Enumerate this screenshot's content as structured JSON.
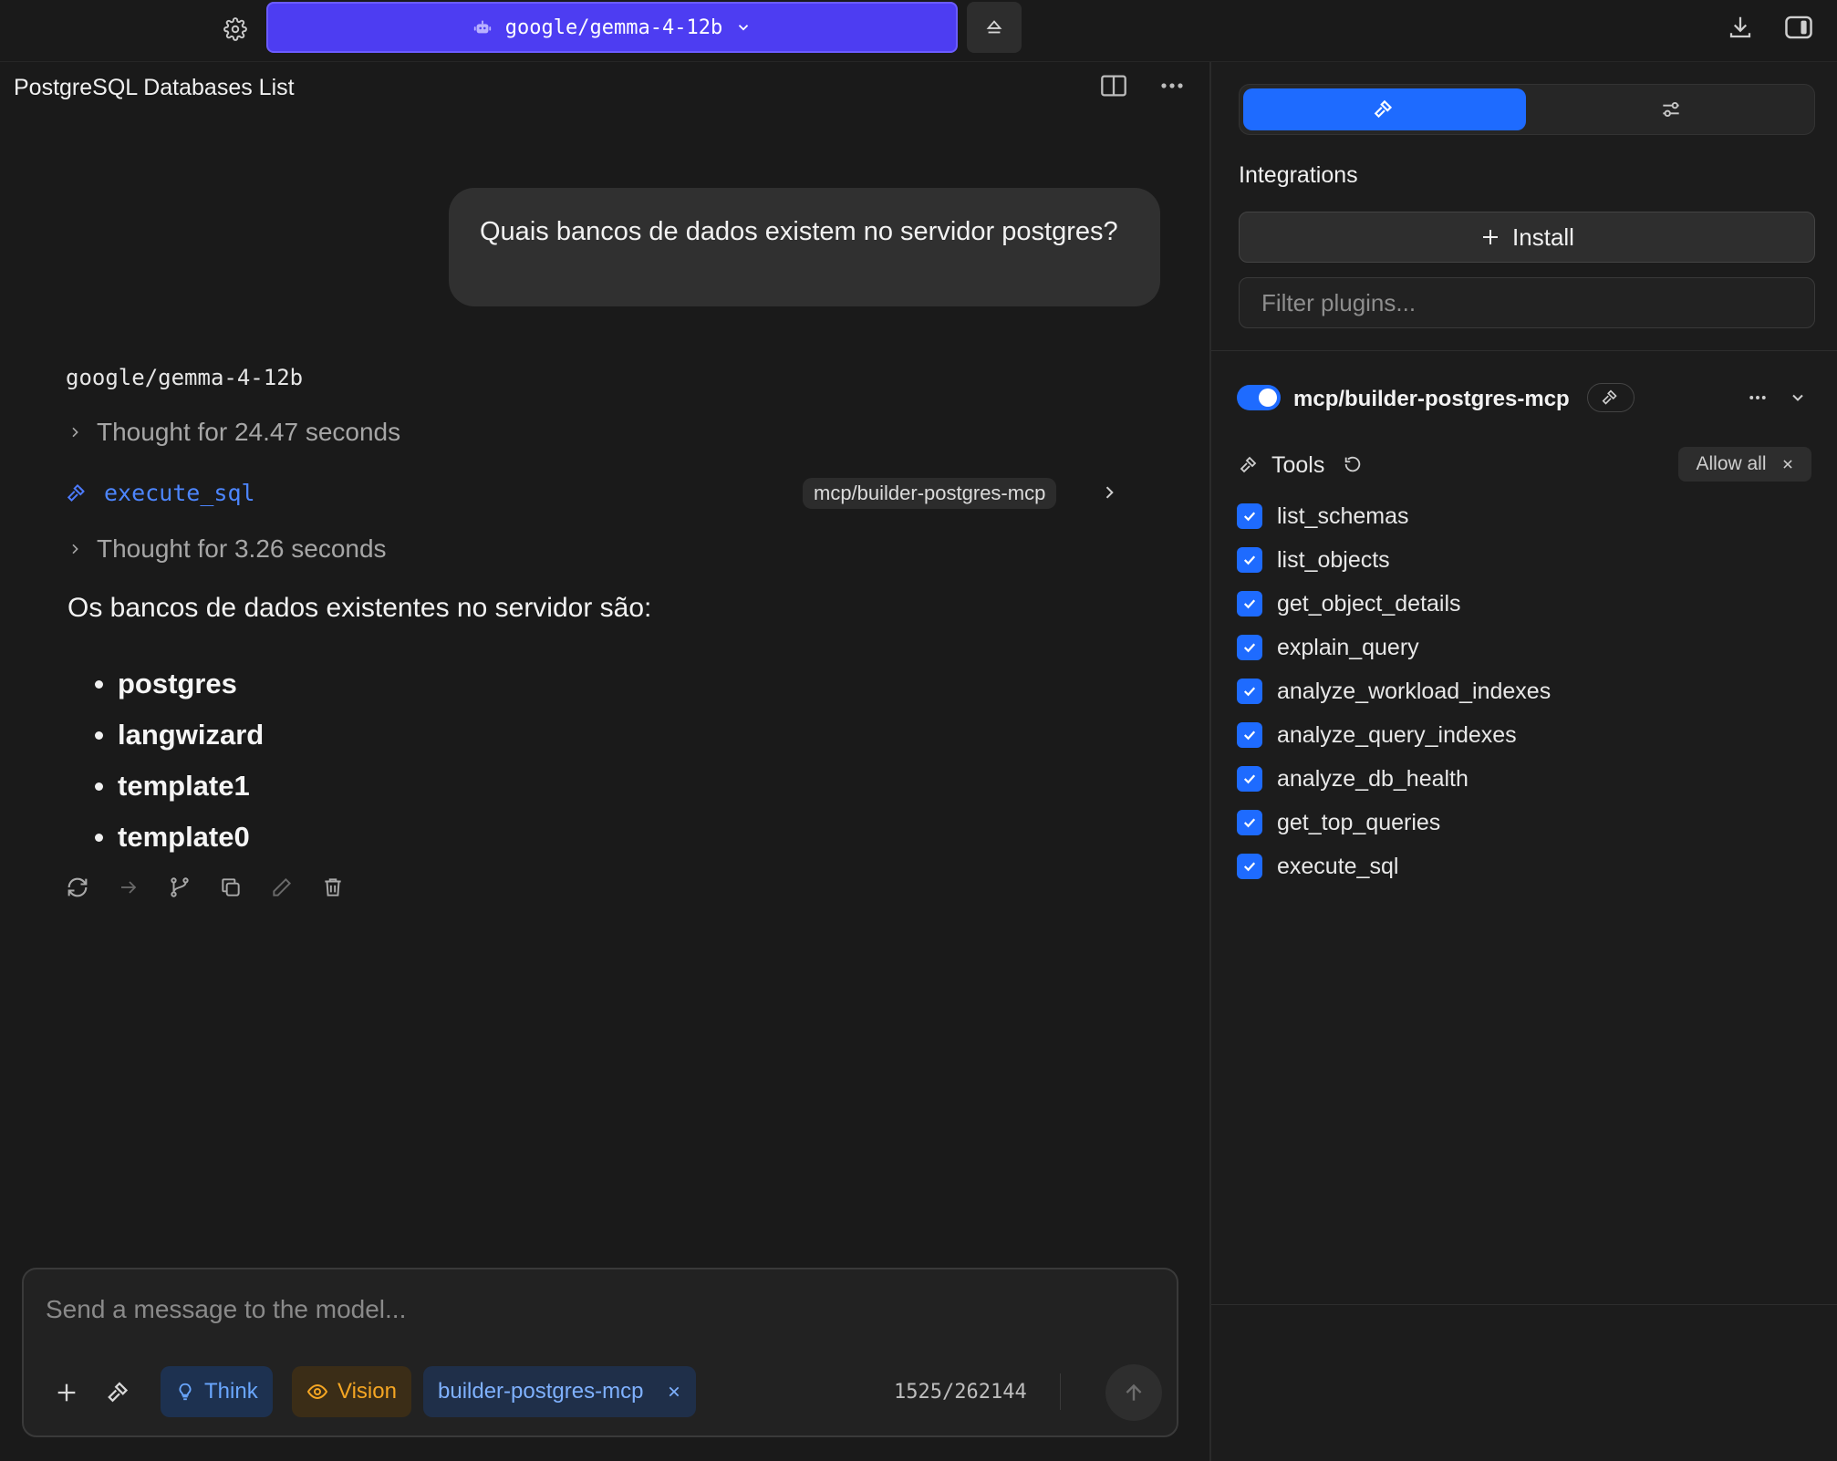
{
  "topbar": {
    "model_name": "google/gemma-4-12b",
    "icons": [
      "gear-icon",
      "robot-icon",
      "chevron-down-icon",
      "eject-icon",
      "download-icon",
      "sidebar-toggle-icon"
    ]
  },
  "chat": {
    "title": "PostgreSQL Databases List",
    "user_message": "Quais bancos de dados existem no servidor postgres?",
    "assistant_model": "google/gemma-4-12b",
    "thought_1": "Thought for 24.47 seconds",
    "tool_call": {
      "name": "execute_sql",
      "server": "mcp/builder-postgres-mcp"
    },
    "thought_2": "Thought for 3.26 seconds",
    "answer_intro": "Os bancos de dados existentes no servidor são:",
    "databases": [
      "postgres",
      "langwizard",
      "template1",
      "template0"
    ],
    "actions": [
      "regenerate-icon",
      "continue-icon",
      "branch-icon",
      "copy-icon",
      "edit-icon",
      "delete-icon"
    ]
  },
  "composer": {
    "placeholder": "Send a message to the model...",
    "think_label": "Think",
    "vision_label": "Vision",
    "mcp_label": "builder-postgres-mcp",
    "token_count": "1525/262144",
    "colors": {
      "think": "#6aa7ff",
      "vision": "#f5a623",
      "mcp": "#7fb1ff"
    }
  },
  "panel": {
    "integrations_heading": "Integrations",
    "install_label": "Install",
    "filter_placeholder": "Filter plugins...",
    "plugin": {
      "name": "mcp/builder-postgres-mcp",
      "enabled": true
    },
    "tools_label": "Tools",
    "allow_all_label": "Allow all",
    "tools": [
      "list_schemas",
      "list_objects",
      "get_object_details",
      "explain_query",
      "analyze_workload_indexes",
      "analyze_query_indexes",
      "analyze_db_health",
      "get_top_queries",
      "execute_sql"
    ],
    "accent_color": "#1e6bff"
  }
}
